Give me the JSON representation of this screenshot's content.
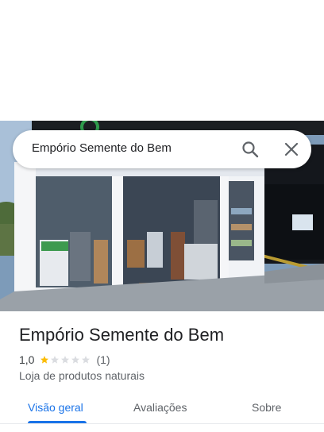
{
  "search": {
    "query": "Empório Semente do Bem"
  },
  "place": {
    "name": "Empório Semente do Bem",
    "rating": "1,0",
    "stars_filled": 1,
    "stars_total": 5,
    "review_count": "(1)",
    "category": "Loja de produtos naturais"
  },
  "tabs": [
    {
      "label": "Visão geral",
      "active": true
    },
    {
      "label": "Avaliações",
      "active": false
    },
    {
      "label": "Sobre",
      "active": false
    }
  ],
  "colors": {
    "accent": "#1a73e8",
    "star": "#fbbc04",
    "star_empty": "#dadce0"
  }
}
